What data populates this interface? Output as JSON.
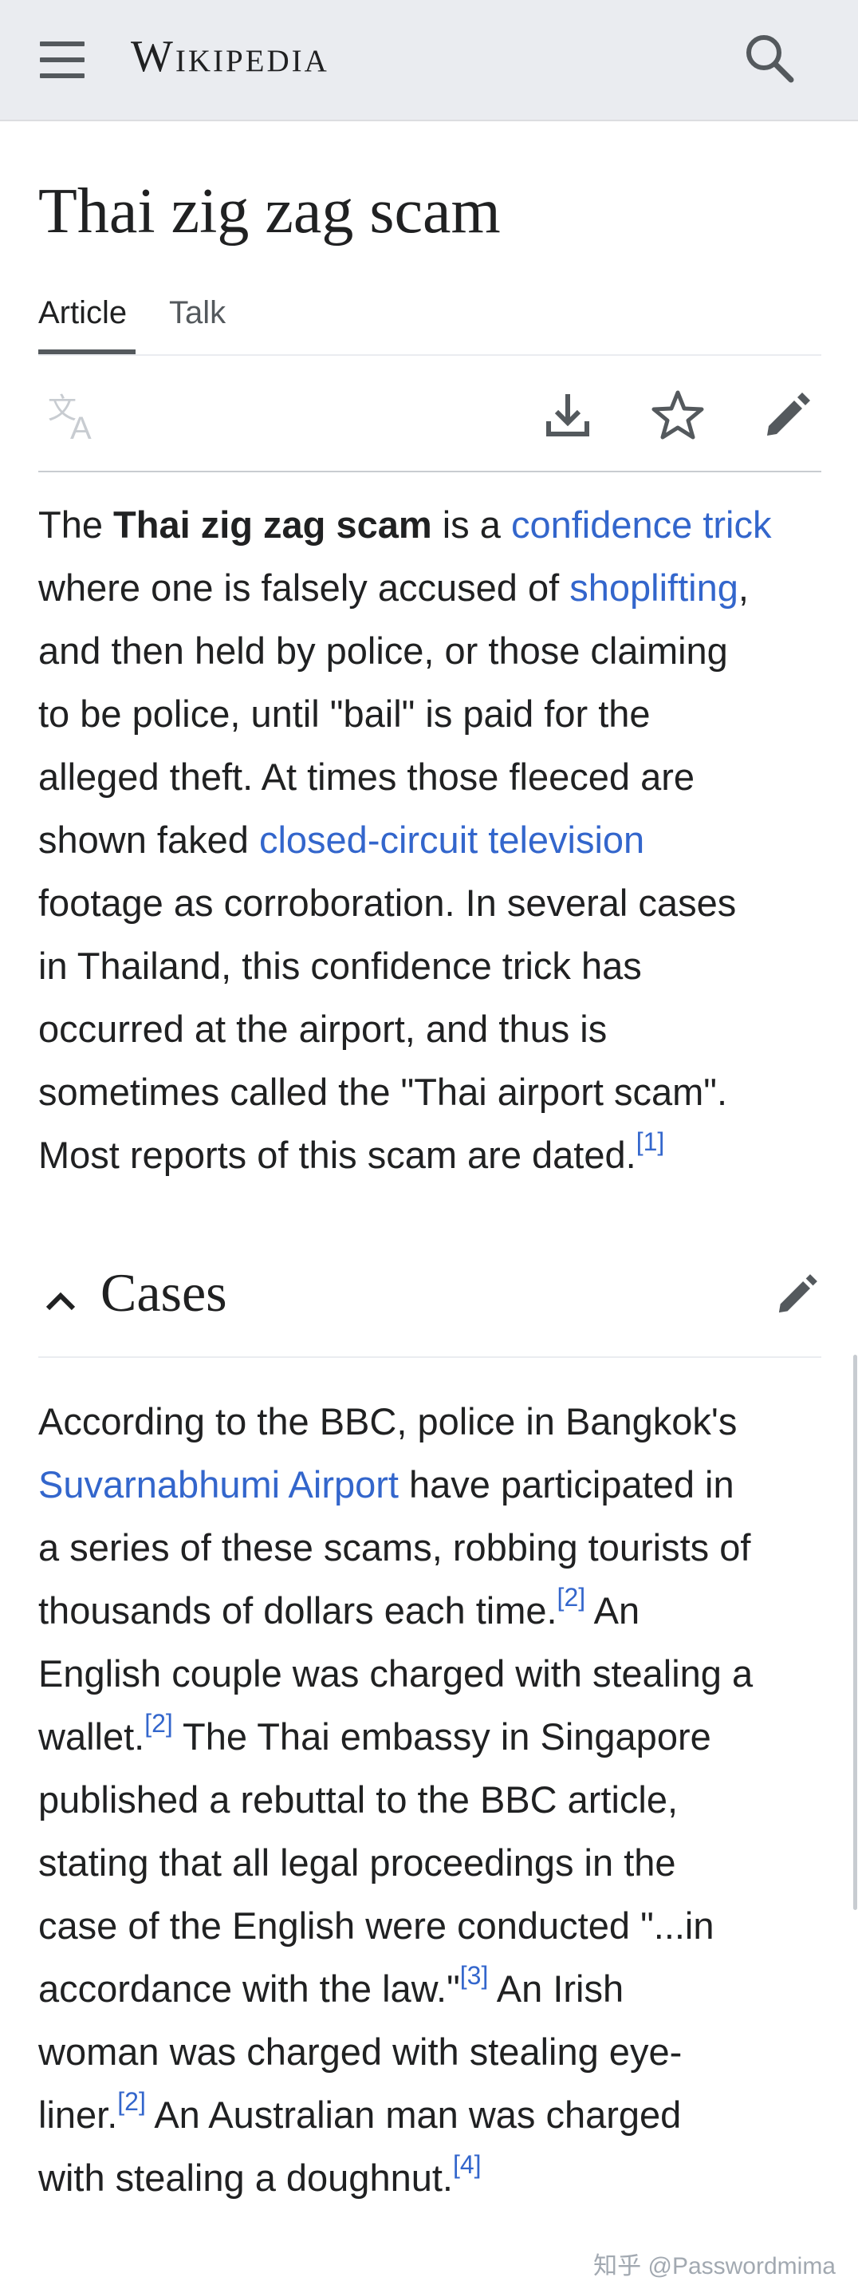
{
  "header": {
    "wordmark": "Wikipedia"
  },
  "article": {
    "title": "Thai zig zag scam",
    "tabs": [
      {
        "label": "Article"
      },
      {
        "label": "Talk"
      }
    ]
  },
  "intro": {
    "t1": "The ",
    "bold": "Thai zig zag scam",
    "t2": " is a ",
    "link1": "confidence trick",
    "t3": "where one is falsely accused of ",
    "link2": "shoplifting",
    "t4": ",",
    "t5": "and then held by police, or those claiming",
    "t6": "to be police, until \"bail\" is paid for the",
    "t7": "alleged theft. At times those fleeced are",
    "t8": "shown faked ",
    "link3": "closed-circuit television",
    "t9": "footage as corroboration. In several cases",
    "t10": "in Thailand, this confidence trick has",
    "t11": "occurred at the airport, and thus is",
    "t12": "sometimes called the \"Thai airport scam\".",
    "t13": "Most reports of this scam are dated.",
    "cite1": "[1]"
  },
  "cases": {
    "heading": "Cases",
    "c1": "According to the BBC, police in Bangkok's",
    "link1": "Suvarnabhumi Airport",
    "c2": " have participated in",
    "c3": "a series of these scams, robbing tourists of",
    "c4": "thousands of dollars each time.",
    "cite2": "[2]",
    "c5": " An",
    "c6": "English couple was charged with stealing a",
    "c7": "wallet.",
    "cite3": "[2]",
    "c8": " The Thai embassy in Singapore",
    "c9": "published a rebuttal to the BBC article,",
    "c10": "stating that all legal proceedings in the",
    "c11": "case of the English were conducted \"...in",
    "c12": "accordance with the law.\"",
    "cite4": "[3]",
    "c13": " An Irish",
    "c14": "woman was charged with stealing eye-",
    "c15": "liner.",
    "cite5": "[2]",
    "c16": " An Australian man was charged",
    "c17": "with stealing a doughnut.",
    "cite6": "[4]"
  },
  "watermark": "知乎 @Passwordmima",
  "colors": {
    "link": "#3366cc",
    "text": "#202122",
    "header_bg": "#eaecf0",
    "icon": "#54595d"
  }
}
